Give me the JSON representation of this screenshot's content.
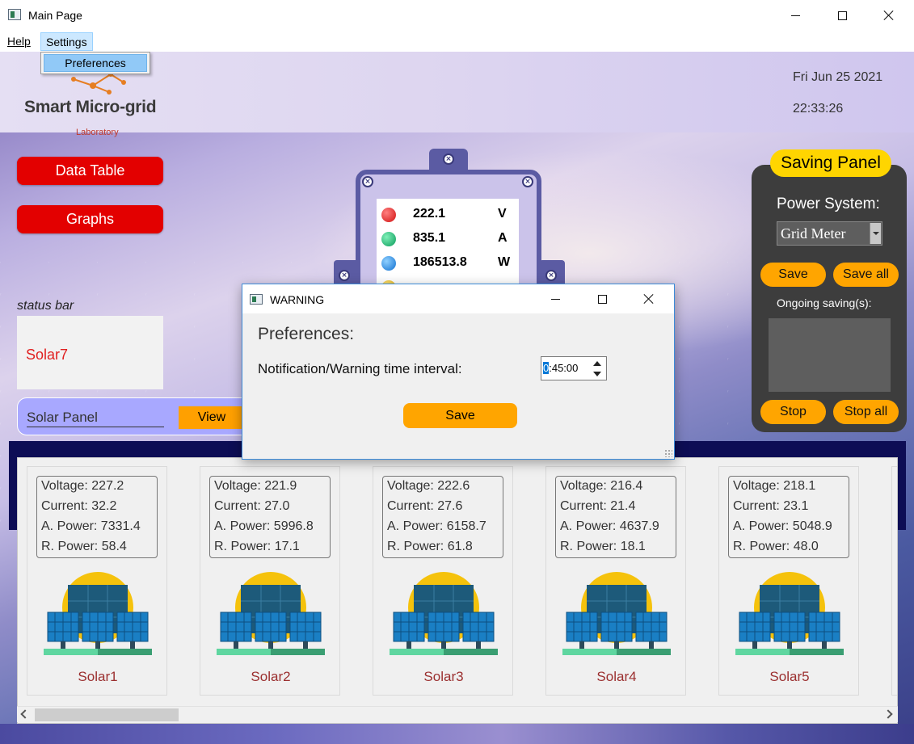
{
  "window": {
    "title": "Main Page"
  },
  "menu": {
    "help": "Help",
    "settings": "Settings",
    "settings_items": [
      "Preferences"
    ]
  },
  "header": {
    "logo_title": "Smart Micro-grid",
    "logo_subtitle": "Laboratory",
    "date": "Fri Jun 25 2021",
    "time": "22:33:26"
  },
  "nav": {
    "data_table": "Data Table",
    "graphs": "Graphs"
  },
  "status": {
    "label": "status bar",
    "value": "Solar7"
  },
  "solar_panel_bar": {
    "label": "Solar Panel",
    "view": "View"
  },
  "meter": {
    "readings": [
      {
        "value": "222.1",
        "unit": "V",
        "color": "#e02020"
      },
      {
        "value": "835.1",
        "unit": "A",
        "color": "#12b070"
      },
      {
        "value": "186513.8",
        "unit": "W",
        "color": "#1e8fe0"
      }
    ]
  },
  "saving_panel": {
    "title": "Saving Panel",
    "power_system_label": "Power System:",
    "power_system_value": "Grid Meter",
    "save": "Save",
    "save_all": "Save all",
    "ongoing_label": "Ongoing saving(s):",
    "stop": "Stop",
    "stop_all": "Stop all"
  },
  "solars": [
    {
      "name": "Solar1",
      "voltage": "Voltage: 227.2",
      "current": "Current: 32.2",
      "a_power": "A. Power: 7331.4",
      "r_power": "R. Power: 58.4"
    },
    {
      "name": "Solar2",
      "voltage": "Voltage: 221.9",
      "current": "Current: 27.0",
      "a_power": "A. Power: 5996.8",
      "r_power": "R. Power: 17.1"
    },
    {
      "name": "Solar3",
      "voltage": "Voltage: 222.6",
      "current": "Current: 27.6",
      "a_power": "A. Power: 6158.7",
      "r_power": "R. Power: 61.8"
    },
    {
      "name": "Solar4",
      "voltage": "Voltage: 216.4",
      "current": "Current: 21.4",
      "a_power": "A. Power: 4637.9",
      "r_power": "R. Power: 18.1"
    },
    {
      "name": "Solar5",
      "voltage": "Voltage: 218.1",
      "current": "Current: 23.1",
      "a_power": "A. Power: 5048.9",
      "r_power": "R. Power: 48.0"
    }
  ],
  "dialog": {
    "title": "WARNING",
    "heading": "Preferences:",
    "interval_label": "Notification/Warning time interval:",
    "interval_selected": "0",
    "interval_rest": ":45:00",
    "save": "Save"
  },
  "colors": {
    "accent_orange": "#ffa500",
    "nav_red": "#e30000",
    "saving_title_yellow": "#ffd500",
    "solar_name": "#9b2f2f"
  }
}
